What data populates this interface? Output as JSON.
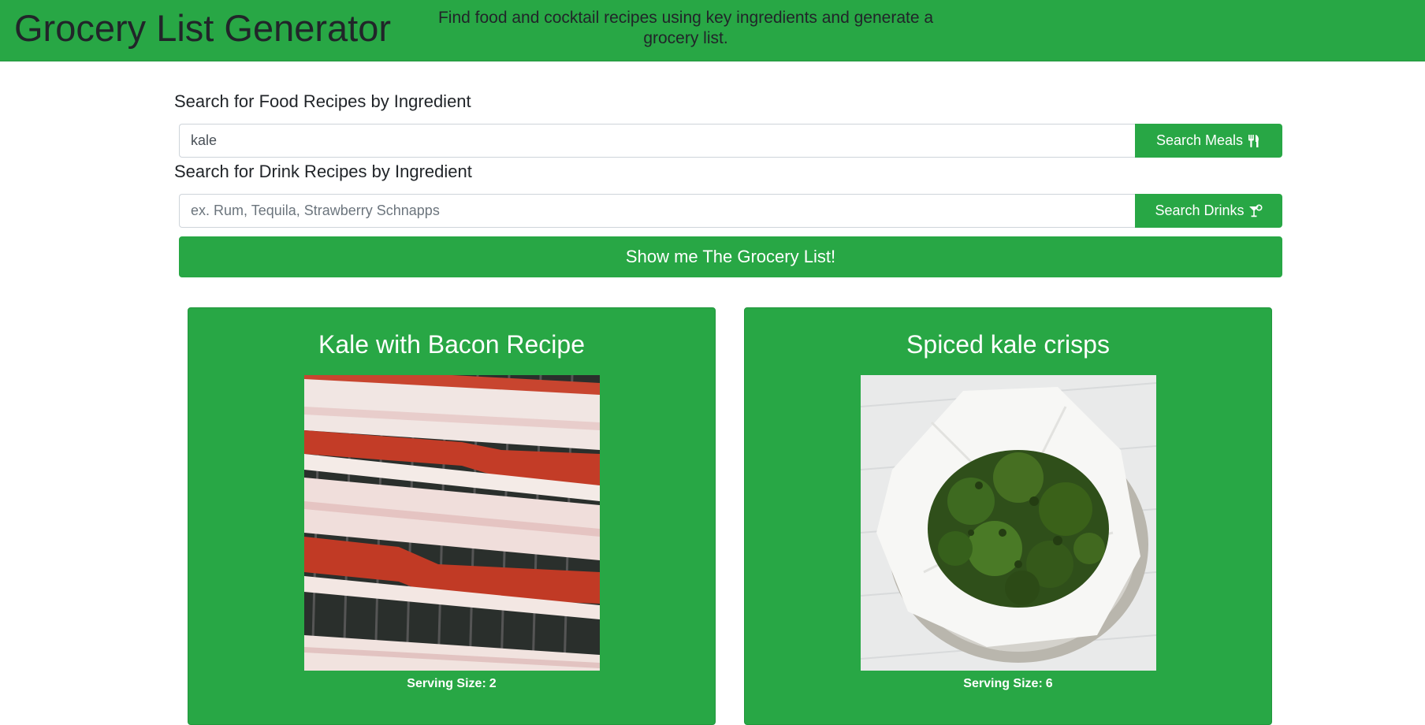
{
  "header": {
    "title": "Grocery List Generator",
    "tagline": "Find food and cocktail recipes using key ingredients and generate a grocery list."
  },
  "food_search": {
    "label": "Search for Food Recipes by Ingredient",
    "value": "kale",
    "placeholder": "",
    "button_label": "Search Meals",
    "button_icon": "utensils-icon"
  },
  "drink_search": {
    "label": "Search for Drink Recipes by Ingredient",
    "value": "",
    "placeholder": "ex. Rum, Tequila, Strawberry Schnapps",
    "button_label": "Search Drinks",
    "button_icon": "cocktail-icon"
  },
  "grocery_button": {
    "label": "Show me The Grocery List!"
  },
  "recipes": [
    {
      "title": "Kale with Bacon Recipe",
      "image": "bacon-photo",
      "serving_label": "Serving Size:",
      "serving_value": "2"
    },
    {
      "title": "Spiced kale crisps",
      "image": "kale-crisps-photo",
      "serving_label": "Serving Size:",
      "serving_value": "6"
    }
  ],
  "colors": {
    "accent": "#28a745",
    "text_dark": "#212529",
    "text_light": "#ffffff"
  }
}
